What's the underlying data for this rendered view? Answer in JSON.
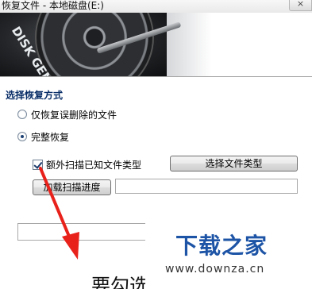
{
  "window": {
    "title": "恢复文件 - 本地磁盘(E:)",
    "close_symbol": "×"
  },
  "banner": {
    "logo_text": "DISK GENIUS"
  },
  "panel": {
    "section_title": "选择恢复方式",
    "options": [
      {
        "label": "仅恢复误删除的文件",
        "selected": false
      },
      {
        "label": "完整恢复",
        "selected": true
      }
    ],
    "extra_scan": {
      "label": "额外扫描已知文件类型",
      "checked": true
    },
    "select_types_button": "选择文件类型",
    "load_progress_button": "加载扫描进度",
    "progress_path_value": "",
    "lower_field_value": ""
  },
  "overlay": {
    "caption": "要勾选",
    "watermark_main": "下载之家",
    "watermark_sub": "www.downza.cn",
    "arrow_color": "#e8221b"
  }
}
